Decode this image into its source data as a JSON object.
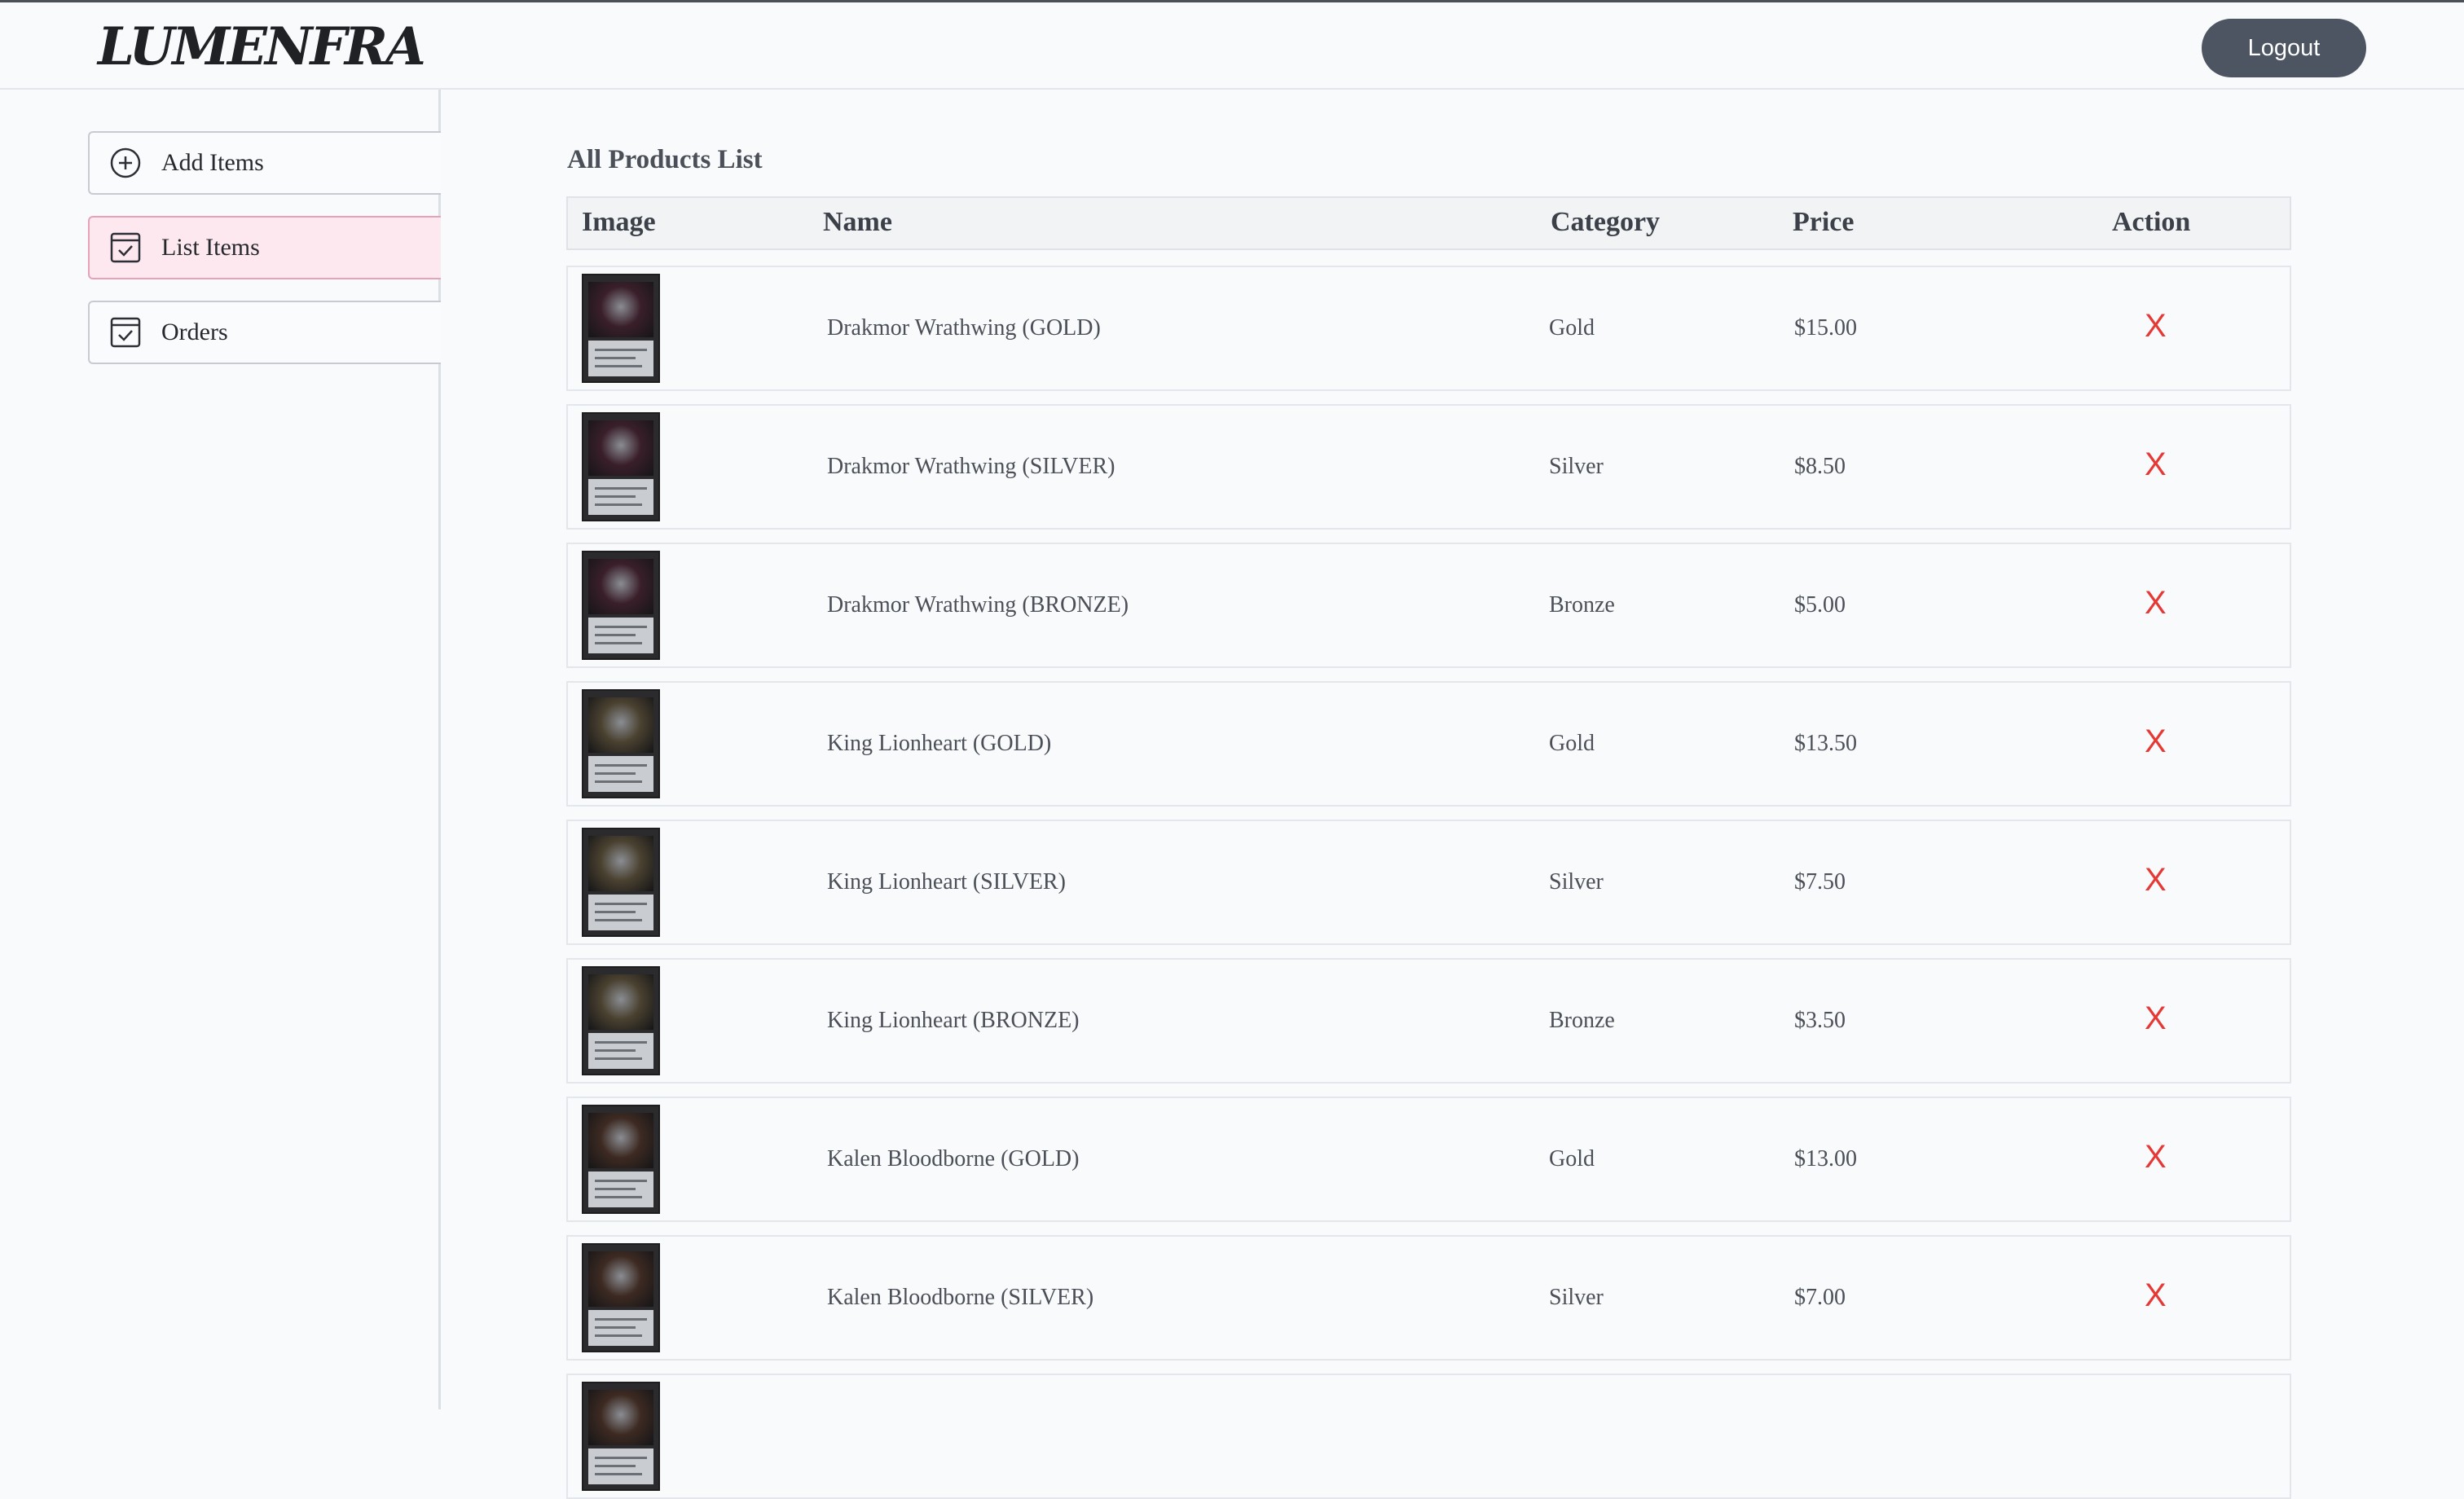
{
  "header": {
    "logo_text": "LUMENFRA",
    "logout_label": "Logout"
  },
  "sidebar": {
    "items": [
      {
        "label": "Add Items",
        "icon": "plus-circle-icon",
        "active": false
      },
      {
        "label": "List Items",
        "icon": "checkbox-icon",
        "active": true
      },
      {
        "label": "Orders",
        "icon": "checkbox-icon",
        "active": false
      }
    ]
  },
  "main": {
    "title": "All Products List",
    "columns": [
      "Image",
      "Name",
      "Category",
      "Price",
      "Action"
    ],
    "rows": [
      {
        "name": "Drakmor Wrathwing (GOLD)",
        "category": "Gold",
        "price": "$15.00",
        "action": "X",
        "art_color": "#3a1f2a"
      },
      {
        "name": "Drakmor Wrathwing (SILVER)",
        "category": "Silver",
        "price": "$8.50",
        "action": "X",
        "art_color": "#3a1f2a"
      },
      {
        "name": "Drakmor Wrathwing (BRONZE)",
        "category": "Bronze",
        "price": "$5.00",
        "action": "X",
        "art_color": "#3a1f2a"
      },
      {
        "name": "King Lionheart (GOLD)",
        "category": "Gold",
        "price": "$13.50",
        "action": "X",
        "art_color": "#4a4130"
      },
      {
        "name": "King Lionheart (SILVER)",
        "category": "Silver",
        "price": "$7.50",
        "action": "X",
        "art_color": "#4a4130"
      },
      {
        "name": "King Lionheart (BRONZE)",
        "category": "Bronze",
        "price": "$3.50",
        "action": "X",
        "art_color": "#4a4130"
      },
      {
        "name": "Kalen Bloodborne (GOLD)",
        "category": "Gold",
        "price": "$13.00",
        "action": "X",
        "art_color": "#3d2a22"
      },
      {
        "name": "Kalen Bloodborne (SILVER)",
        "category": "Silver",
        "price": "$7.00",
        "action": "X",
        "art_color": "#3d2a22"
      },
      {
        "name": "",
        "category": "",
        "price": "",
        "action": "",
        "art_color": "#3d2a22"
      }
    ]
  },
  "colors": {
    "logout_bg": "#4d5562",
    "active_nav_bg": "#fde8ef",
    "delete_x": "#e53935"
  }
}
